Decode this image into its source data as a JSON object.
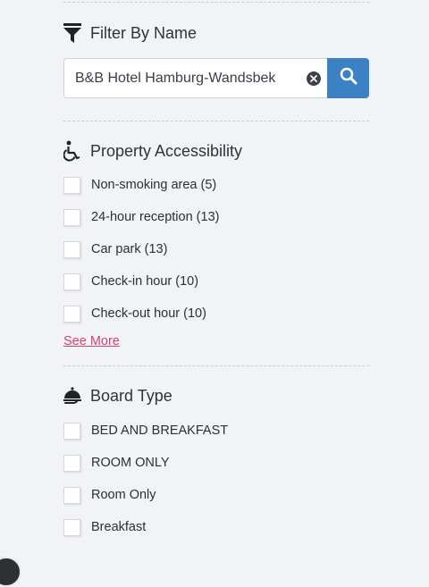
{
  "filter_by_name": {
    "title": "Filter By Name",
    "icon": "funnel-icon",
    "input_value": "B&B Hotel Hamburg-Wandsbek",
    "clear_icon": "clear-circle-icon",
    "search_icon": "search-icon",
    "search_button_color": "#3a82c4"
  },
  "property_accessibility": {
    "title": "Property Accessibility",
    "icon": "wheelchair-icon",
    "items": [
      {
        "label": "Non-smoking area (5)",
        "checked": false
      },
      {
        "label": "24-hour reception (13)",
        "checked": false
      },
      {
        "label": "Car park (13)",
        "checked": false
      },
      {
        "label": "Check-in hour (10)",
        "checked": false
      },
      {
        "label": "Check-out hour (10)",
        "checked": false
      }
    ],
    "see_more": "See More",
    "see_more_color": "#d2456b"
  },
  "board_type": {
    "title": "Board Type",
    "icon": "room-service-icon",
    "items": [
      {
        "label": "BED AND BREAKFAST",
        "checked": false
      },
      {
        "label": "ROOM ONLY",
        "checked": false
      },
      {
        "label": "Room Only",
        "checked": false
      },
      {
        "label": "Breakfast",
        "checked": false
      }
    ]
  }
}
